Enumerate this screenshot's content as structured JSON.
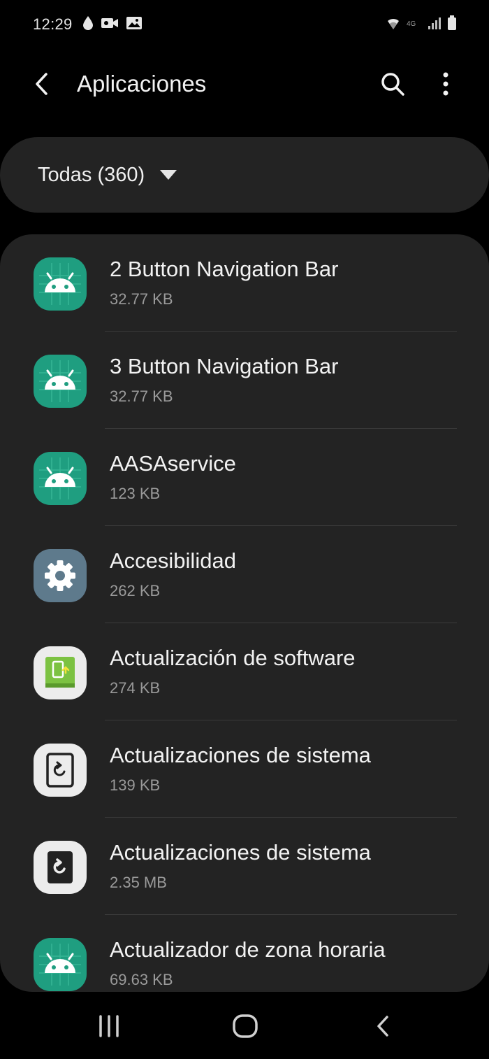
{
  "status_bar": {
    "time": "12:29",
    "left_icons": [
      "water-drop-icon",
      "video-camera-icon",
      "image-icon"
    ],
    "right_icons": [
      "wifi-icon",
      "network-4g-icon",
      "signal-icon",
      "battery-icon"
    ]
  },
  "header": {
    "title": "Aplicaciones",
    "icons": [
      "back-arrow-icon",
      "search-icon",
      "more-vert-icon"
    ]
  },
  "filter": {
    "label": "Todas (360)",
    "icon": "dropdown-caret-icon"
  },
  "apps": [
    {
      "name": "2 Button Navigation Bar",
      "size": "32.77 KB",
      "icon": "android-icon"
    },
    {
      "name": "3 Button Navigation Bar",
      "size": "32.77 KB",
      "icon": "android-icon"
    },
    {
      "name": "AASAservice",
      "size": "123 KB",
      "icon": "android-icon"
    },
    {
      "name": "Accesibilidad",
      "size": "262 KB",
      "icon": "gear-icon"
    },
    {
      "name": "Actualización de software",
      "size": "274 KB",
      "icon": "software-update-icon"
    },
    {
      "name": "Actualizaciones de sistema",
      "size": "139 KB",
      "icon": "system-update-outline-icon"
    },
    {
      "name": "Actualizaciones de sistema",
      "size": "2.35 MB",
      "icon": "system-update-filled-icon"
    },
    {
      "name": "Actualizador de zona horaria",
      "size": "69.63 KB",
      "icon": "android-icon"
    }
  ],
  "nav_bar": {
    "icons": [
      "recents-icon",
      "home-icon",
      "back-icon"
    ]
  },
  "colors": {
    "background": "#000000",
    "surface": "#232323",
    "text_primary": "#f2f2f2",
    "text_secondary": "#9a9a9a",
    "android_icon_bg": "#1f9e80"
  }
}
